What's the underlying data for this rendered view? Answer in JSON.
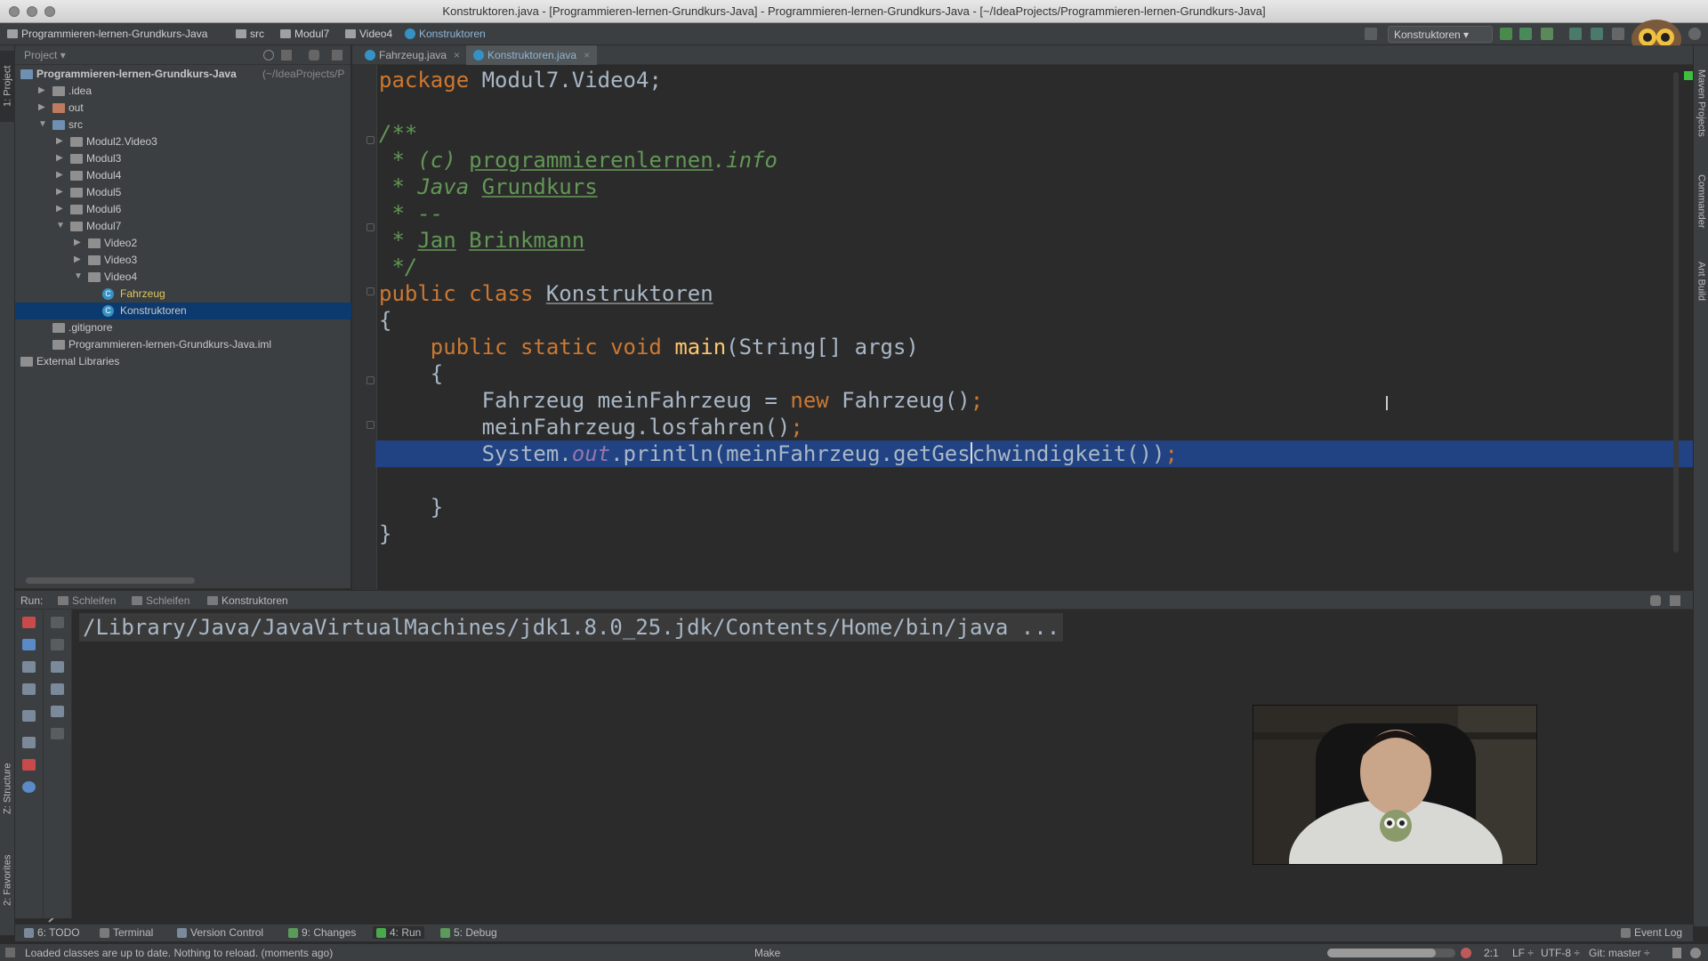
{
  "window": {
    "title": "Konstruktoren.java - [Programmieren-lernen-Grundkurs-Java] - Programmieren-lernen-Grundkurs-Java - [~/IdeaProjects/Programmieren-lernen-Grundkurs-Java]"
  },
  "navbar": {
    "crumbs": [
      "Programmieren-lernen-Grundkurs-Java",
      "src",
      "Modul7",
      "Video4",
      "Konstruktoren"
    ],
    "run_config": "Konstruktoren"
  },
  "project": {
    "panel_label": "Project",
    "tree": [
      {
        "label": "Programmieren-lernen-Grundkurs-Java",
        "suffix": "(~/IdeaProjects/P",
        "level": 0,
        "type": "project"
      },
      {
        "label": ".idea",
        "level": 1,
        "type": "folder",
        "arrow": "▶"
      },
      {
        "label": "out",
        "level": 1,
        "type": "folder-red",
        "arrow": "▶"
      },
      {
        "label": "src",
        "level": 1,
        "type": "folder-blue",
        "arrow": "▼"
      },
      {
        "label": "Modul2.Video3",
        "level": 2,
        "type": "package",
        "arrow": "▶"
      },
      {
        "label": "Modul3",
        "level": 2,
        "type": "package",
        "arrow": "▶"
      },
      {
        "label": "Modul4",
        "level": 2,
        "type": "package",
        "arrow": "▶"
      },
      {
        "label": "Modul5",
        "level": 2,
        "type": "package",
        "arrow": "▶"
      },
      {
        "label": "Modul6",
        "level": 2,
        "type": "package",
        "arrow": "▶"
      },
      {
        "label": "Modul7",
        "level": 2,
        "type": "package",
        "arrow": "▼"
      },
      {
        "label": "Video2",
        "level": 3,
        "type": "package",
        "arrow": "▶"
      },
      {
        "label": "Video3",
        "level": 3,
        "type": "package",
        "arrow": "▶"
      },
      {
        "label": "Video4",
        "level": 3,
        "type": "package",
        "arrow": "▼"
      },
      {
        "label": "Fahrzeug",
        "level": 4,
        "type": "class"
      },
      {
        "label": "Konstruktoren",
        "level": 4,
        "type": "class",
        "selected": true
      },
      {
        "label": ".gitignore",
        "level": 1,
        "type": "file"
      },
      {
        "label": "Programmieren-lernen-Grundkurs-Java.iml",
        "level": 1,
        "type": "file"
      },
      {
        "label": "External Libraries",
        "level": 0,
        "type": "library"
      }
    ]
  },
  "editor": {
    "tabs": [
      {
        "label": "Fahrzeug.java",
        "active": false
      },
      {
        "label": "Konstruktoren.java",
        "active": true
      }
    ],
    "code": {
      "l1_kw": "package",
      "l1_rest": " Modul7.Video4;",
      "c_open": "/**",
      "c1_a": " * (c) ",
      "c1_b": "programmierenlernen",
      "c1_c": ".info",
      "c2_a": " * Java ",
      "c2_b": "Grundkurs",
      "c3": " * --",
      "c4_a": " * ",
      "c4_b": "Jan",
      "c4_c": " ",
      "c4_d": "Brinkmann",
      "c_close": " */",
      "cls_kw": "public class ",
      "cls_name": "Konstruktoren",
      "brace_open": "{",
      "main_kw": "    public static void ",
      "main_fn": "main",
      "main_rest": "(String[] args)",
      "main_brace": "    {",
      "s1_a": "        Fahrzeug meinFahrzeug = ",
      "s1_kw": "new",
      "s1_b": " Fahrzeug()",
      "s1_semi": ";",
      "s2_a": "        meinFahrzeug.losfahren()",
      "s2_semi": ";",
      "s3_a": "        System.",
      "s3_fld": "out",
      "s3_b": ".println(meinFahrzeug.getGes",
      "s3_c": "chwindigkeit())",
      "s3_semi": ";",
      "main_close": "    }",
      "brace_close": "}"
    }
  },
  "run": {
    "label": "Run:",
    "tabs": [
      "Schleifen",
      "Schleifen",
      "Konstruktoren"
    ],
    "console_line": "/Library/Java/JavaVirtualMachines/jdk1.8.0_25.jdk/Contents/Home/bin/java ..."
  },
  "left_stripe": {
    "project": "1: Project",
    "structure": "Z: Structure",
    "favorites": "2: Favorites"
  },
  "right_stripe": {
    "maven": "Maven Projects",
    "commander": "Commander",
    "ant": "Ant Build"
  },
  "bottom_tools": [
    {
      "label": "6: TODO"
    },
    {
      "label": "Terminal"
    },
    {
      "label": "Version Control"
    },
    {
      "label": "9: Changes"
    },
    {
      "label": "4: Run",
      "active": true
    },
    {
      "label": "5: Debug"
    }
  ],
  "event_log": "Event Log",
  "status": {
    "message": "Loaded classes are up to date. Nothing to reload. (moments ago)",
    "make": "Make",
    "position": "2:1",
    "line_sep": "LF ÷",
    "encoding": "UTF-8 ÷",
    "git": "Git: master ÷",
    "progress": 0.85
  },
  "colors": {
    "accent": "#214283",
    "keyword": "#cc7832",
    "comment": "#629755",
    "method": "#ffc66d",
    "field": "#9876aa",
    "text": "#a9b7c6"
  }
}
